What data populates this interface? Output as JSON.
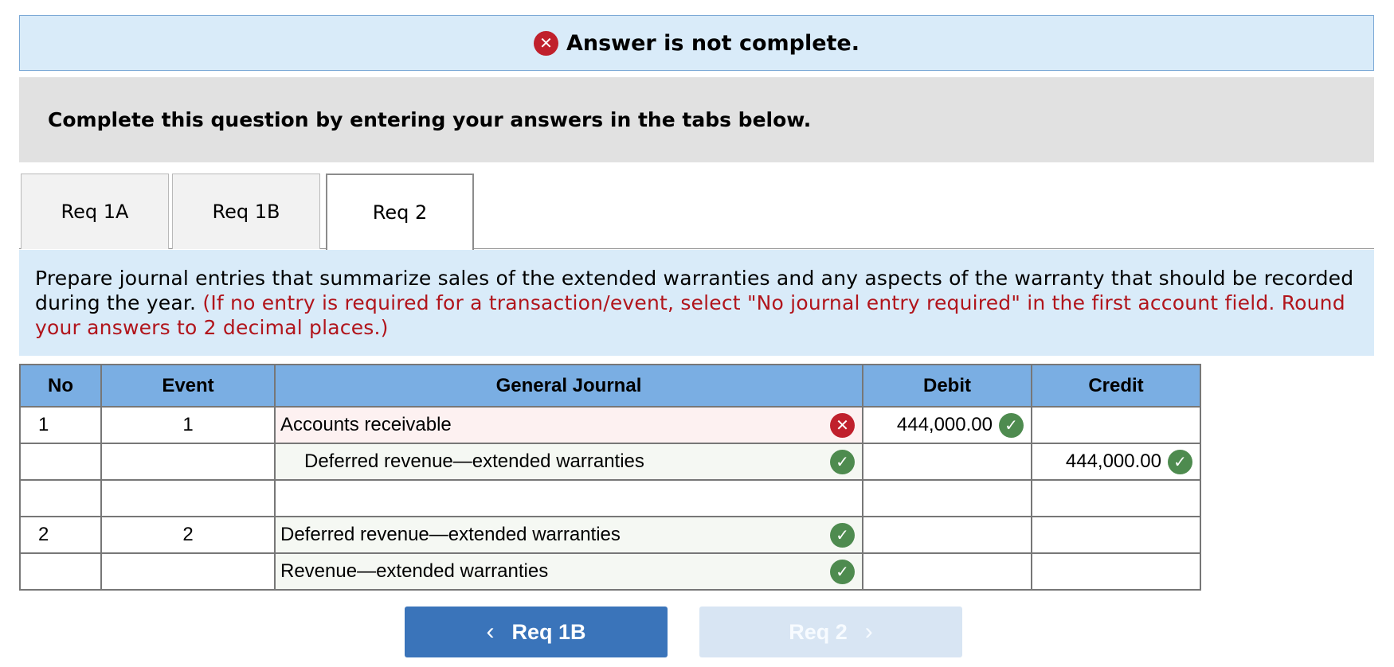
{
  "banner": {
    "icon": "error-x-icon",
    "text": "Answer is not complete."
  },
  "instruction": "Complete this question by entering your answers in the tabs below.",
  "tabs": [
    {
      "label": "Req 1A",
      "active": false
    },
    {
      "label": "Req 1B",
      "active": false
    },
    {
      "label": "Req 2",
      "active": true
    }
  ],
  "question": {
    "text": "Prepare journal entries that summarize sales of the extended warranties and any aspects of the warranty that should be recorded during the year. ",
    "note": "(If no entry is required for a transaction/event, select \"No journal entry required\" in the first account field. Round your answers to 2 decimal places.)"
  },
  "table": {
    "headers": [
      "No",
      "Event",
      "General Journal",
      "Debit",
      "Credit"
    ],
    "rows": [
      {
        "no": "1",
        "event": "1",
        "account": "Accounts receivable",
        "account_status": "incorrect",
        "debit": "444,000.00",
        "debit_status": "correct",
        "credit": "",
        "credit_status": ""
      },
      {
        "no": "",
        "event": "",
        "account": "Deferred revenue—extended warranties",
        "account_status": "correct",
        "debit": "",
        "debit_status": "",
        "credit": "444,000.00",
        "credit_status": "correct"
      },
      {
        "no": "",
        "event": "",
        "account": "",
        "account_status": "",
        "debit": "",
        "debit_status": "",
        "credit": "",
        "credit_status": ""
      },
      {
        "no": "2",
        "event": "2",
        "account": "Deferred revenue—extended warranties",
        "account_status": "correct",
        "debit": "",
        "debit_status": "",
        "credit": "",
        "credit_status": ""
      },
      {
        "no": "",
        "event": "",
        "account": "Revenue—extended warranties",
        "account_status": "correct",
        "debit": "",
        "debit_status": "",
        "credit": "",
        "credit_status": ""
      }
    ]
  },
  "nav": {
    "prev_label": "Req 1B",
    "next_label": "Req 2"
  },
  "colors": {
    "banner_bg": "#d9ebf9",
    "header_bg": "#7aaee3",
    "error": "#c0202c",
    "correct": "#4e8b4f",
    "note_red": "#b1151c",
    "prev_button": "#3a74ba",
    "next_button_disabled": "#d8e5f3"
  }
}
